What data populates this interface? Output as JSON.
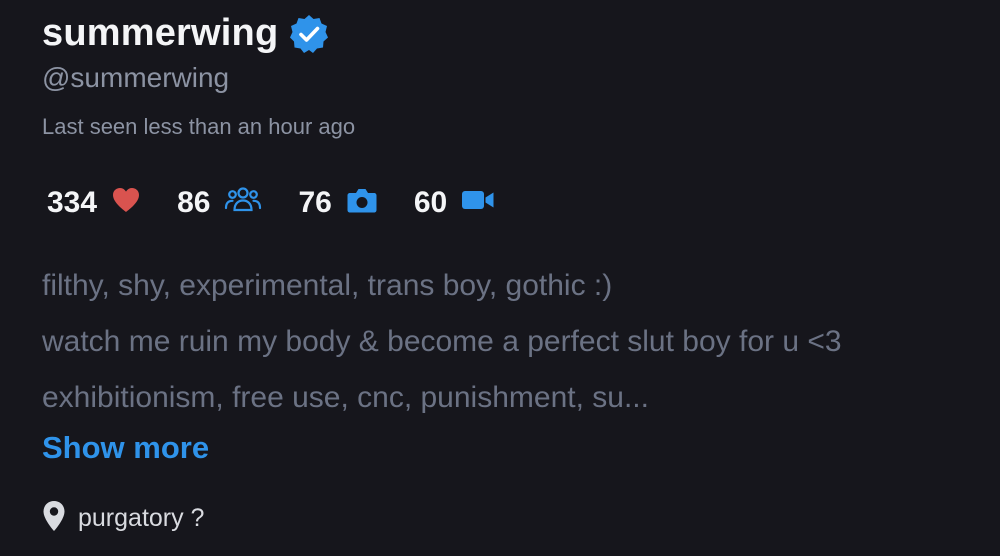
{
  "profile": {
    "display_name": "summerwing",
    "verified": true,
    "handle": "@summerwing",
    "last_seen": "Last seen less than an hour ago"
  },
  "stats": [
    {
      "value": "334",
      "icon": "heart-icon",
      "color": "#d9534f"
    },
    {
      "value": "86",
      "icon": "users-icon",
      "color": "#2f93ea"
    },
    {
      "value": "76",
      "icon": "camera-icon",
      "color": "#2f93ea"
    },
    {
      "value": "60",
      "icon": "video-icon",
      "color": "#2f93ea"
    }
  ],
  "bio": {
    "lines": [
      "filthy, shy, experimental, trans boy, gothic :)",
      "watch me ruin my body & become a perfect slut boy for u <3",
      "exhibitionism, free use, cnc, punishment, su..."
    ],
    "show_more_label": "Show more"
  },
  "location": {
    "icon": "location-pin-icon",
    "text": "purgatory ?"
  },
  "colors": {
    "background": "#16161c",
    "accent": "#2f93ea",
    "heart": "#d9534f",
    "muted_text": "#8c93a3",
    "bio_text": "#6b7284"
  }
}
